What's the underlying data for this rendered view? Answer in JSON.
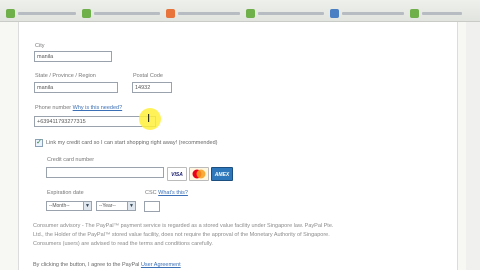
{
  "colors": {
    "link": "#3b6fb6",
    "highlight": "#fff03c",
    "visa": "#1a1f71",
    "mastercard": "#eb001b",
    "amex": "#2e77bb"
  },
  "bookmarks": [
    {
      "icon": "favicon-green-icon",
      "color": "#6fb04a"
    },
    {
      "icon": "favicon-green-icon",
      "color": "#6fb04a"
    },
    {
      "icon": "favicon-orange-icon",
      "color": "#e8743b"
    },
    {
      "icon": "favicon-green-icon",
      "color": "#6fb04a"
    },
    {
      "icon": "favicon-blue-icon",
      "color": "#4b7fc4"
    },
    {
      "icon": "favicon-green-icon",
      "color": "#6fb04a"
    }
  ],
  "form": {
    "city_label": "City",
    "city_value": "manila",
    "state_label": "State / Province / Region",
    "state_value": "manila",
    "postal_label": "Postal Code",
    "postal_value": "14932",
    "phone_label": "Phone number",
    "phone_help": "Why is this needed?",
    "phone_value": "+639411793277315",
    "link_card_label": "Link my credit card so I can start shopping right away! (recommended)",
    "card_number_label": "Credit card number",
    "card_brands": [
      "VISA",
      "MC",
      "AMEX"
    ],
    "expiration_label": "Expiration date",
    "month_value": "--Month--",
    "year_value": "--Year--",
    "csc_label": "CSC",
    "csc_help": "What's this?"
  },
  "disclaimer": {
    "line1": "Consumer advisory - The PayPal™ payment service is regarded as a stored value facility under Singapore law. PayPal Pte.",
    "line2": "Ltd., the Holder of the PayPal™ stored value facility, does not require the approval of the Monetary Authority of Singapore.",
    "line3": "Consumers (users) are advised to read the terms and conditions carefully."
  },
  "agreement": {
    "prefix": "By clicking the button, I agree to the PayPal",
    "link": "User Agreement"
  }
}
